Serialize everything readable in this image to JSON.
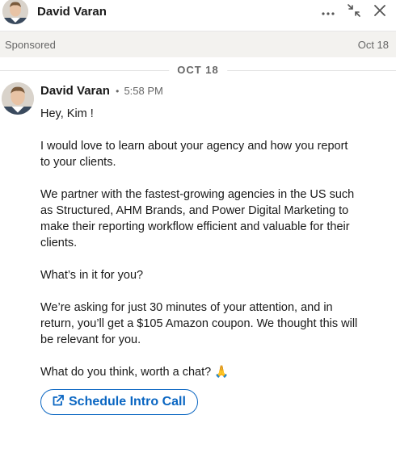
{
  "header": {
    "name": "David Varan",
    "more_icon": "more-horizontal-icon",
    "minimize_icon": "collapse-arrows-icon",
    "close_icon": "close-icon"
  },
  "sponsored": {
    "label": "Sponsored",
    "date": "Oct 18"
  },
  "date_divider": "OCT 18",
  "message": {
    "sender": "David Varan",
    "separator": "•",
    "time": "5:58 PM",
    "paragraphs": [
      "Hey, Kim !",
      "I would love to learn about your agency and how you report to your clients.",
      "We partner with the fastest-growing agencies in the US such as Structured, AHM Brands, and Power Digital Marketing to make their reporting workflow efficient and valuable for their clients.",
      "What’s in it for you?",
      "We’re asking for just 30 minutes of your attention, and in return, you’ll get a $105 Amazon coupon. We thought this will be relevant for you.",
      "What do you think, worth a chat? 🙏"
    ],
    "cta_label": "Schedule Intro Call",
    "cta_icon": "external-link-icon"
  },
  "colors": {
    "accent": "#0a66c2",
    "sponsored_bg": "#f3f2ef"
  }
}
